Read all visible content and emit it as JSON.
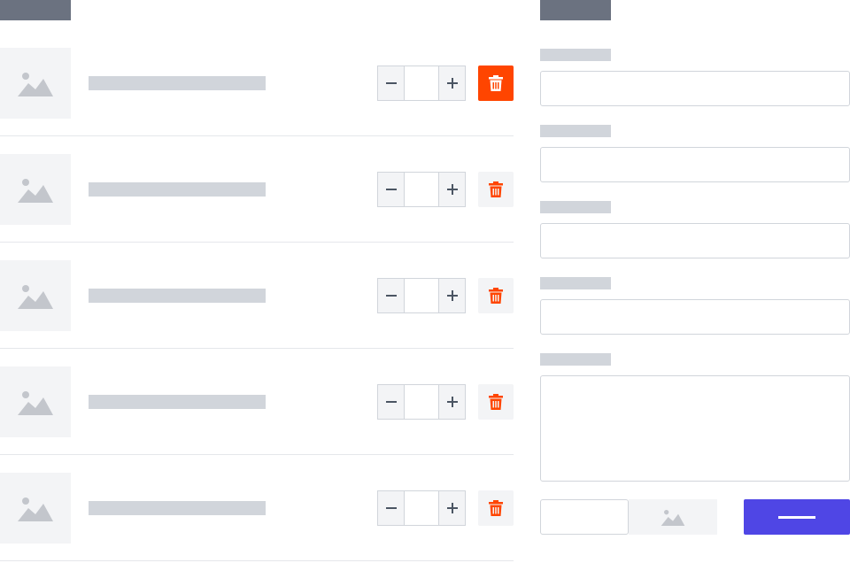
{
  "icons": {
    "thumbnail": "image-placeholder-icon",
    "decrease": "minus-icon",
    "increase": "plus-icon",
    "remove": "trash-icon",
    "captcha": "image-placeholder-icon"
  },
  "colors": {
    "header_bar": "#6b7280",
    "skeleton": "#d1d5db",
    "placeholder_bg": "#f3f4f6",
    "border": "#d1d5db",
    "danger": "#ff4500",
    "primary": "#4f46e5"
  },
  "cart": {
    "items": [
      {
        "quantity": "",
        "delete_active": true
      },
      {
        "quantity": "",
        "delete_active": false
      },
      {
        "quantity": "",
        "delete_active": false
      },
      {
        "quantity": "",
        "delete_active": false
      },
      {
        "quantity": "",
        "delete_active": false
      }
    ]
  },
  "form": {
    "fields": [
      {
        "value": ""
      },
      {
        "value": ""
      },
      {
        "value": ""
      },
      {
        "value": ""
      }
    ],
    "message": {
      "value": ""
    },
    "captcha_code": {
      "value": ""
    }
  }
}
